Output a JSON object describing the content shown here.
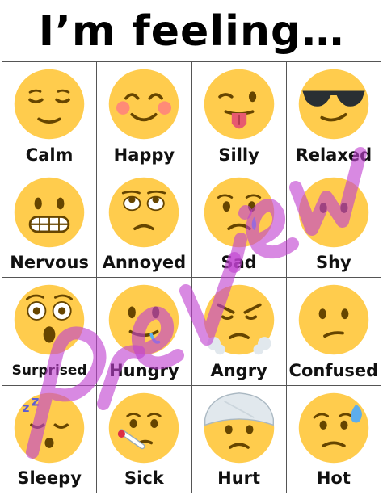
{
  "title": "I’m feeling…",
  "emotions": [
    {
      "label": "Calm",
      "icon": "calm-face-icon"
    },
    {
      "label": "Happy",
      "icon": "happy-face-icon"
    },
    {
      "label": "Silly",
      "icon": "silly-face-icon"
    },
    {
      "label": "Relaxed",
      "icon": "relaxed-face-icon"
    },
    {
      "label": "Nervous",
      "icon": "nervous-face-icon"
    },
    {
      "label": "Annoyed",
      "icon": "annoyed-face-icon"
    },
    {
      "label": "Sad",
      "icon": "sad-face-icon"
    },
    {
      "label": "Shy",
      "icon": "shy-face-icon"
    },
    {
      "label": "Surprised",
      "icon": "surprised-face-icon"
    },
    {
      "label": "Hungry",
      "icon": "hungry-face-icon"
    },
    {
      "label": "Angry",
      "icon": "angry-face-icon"
    },
    {
      "label": "Confused",
      "icon": "confused-face-icon"
    },
    {
      "label": "Sleepy",
      "icon": "sleepy-face-icon"
    },
    {
      "label": "Sick",
      "icon": "sick-face-icon"
    },
    {
      "label": "Hurt",
      "icon": "hurt-face-icon"
    },
    {
      "label": "Hot",
      "icon": "hot-face-icon"
    }
  ],
  "watermark": "Preview",
  "colors": {
    "face": "#FFCC4D",
    "feature": "#664500",
    "watermark": "#C040D0"
  }
}
